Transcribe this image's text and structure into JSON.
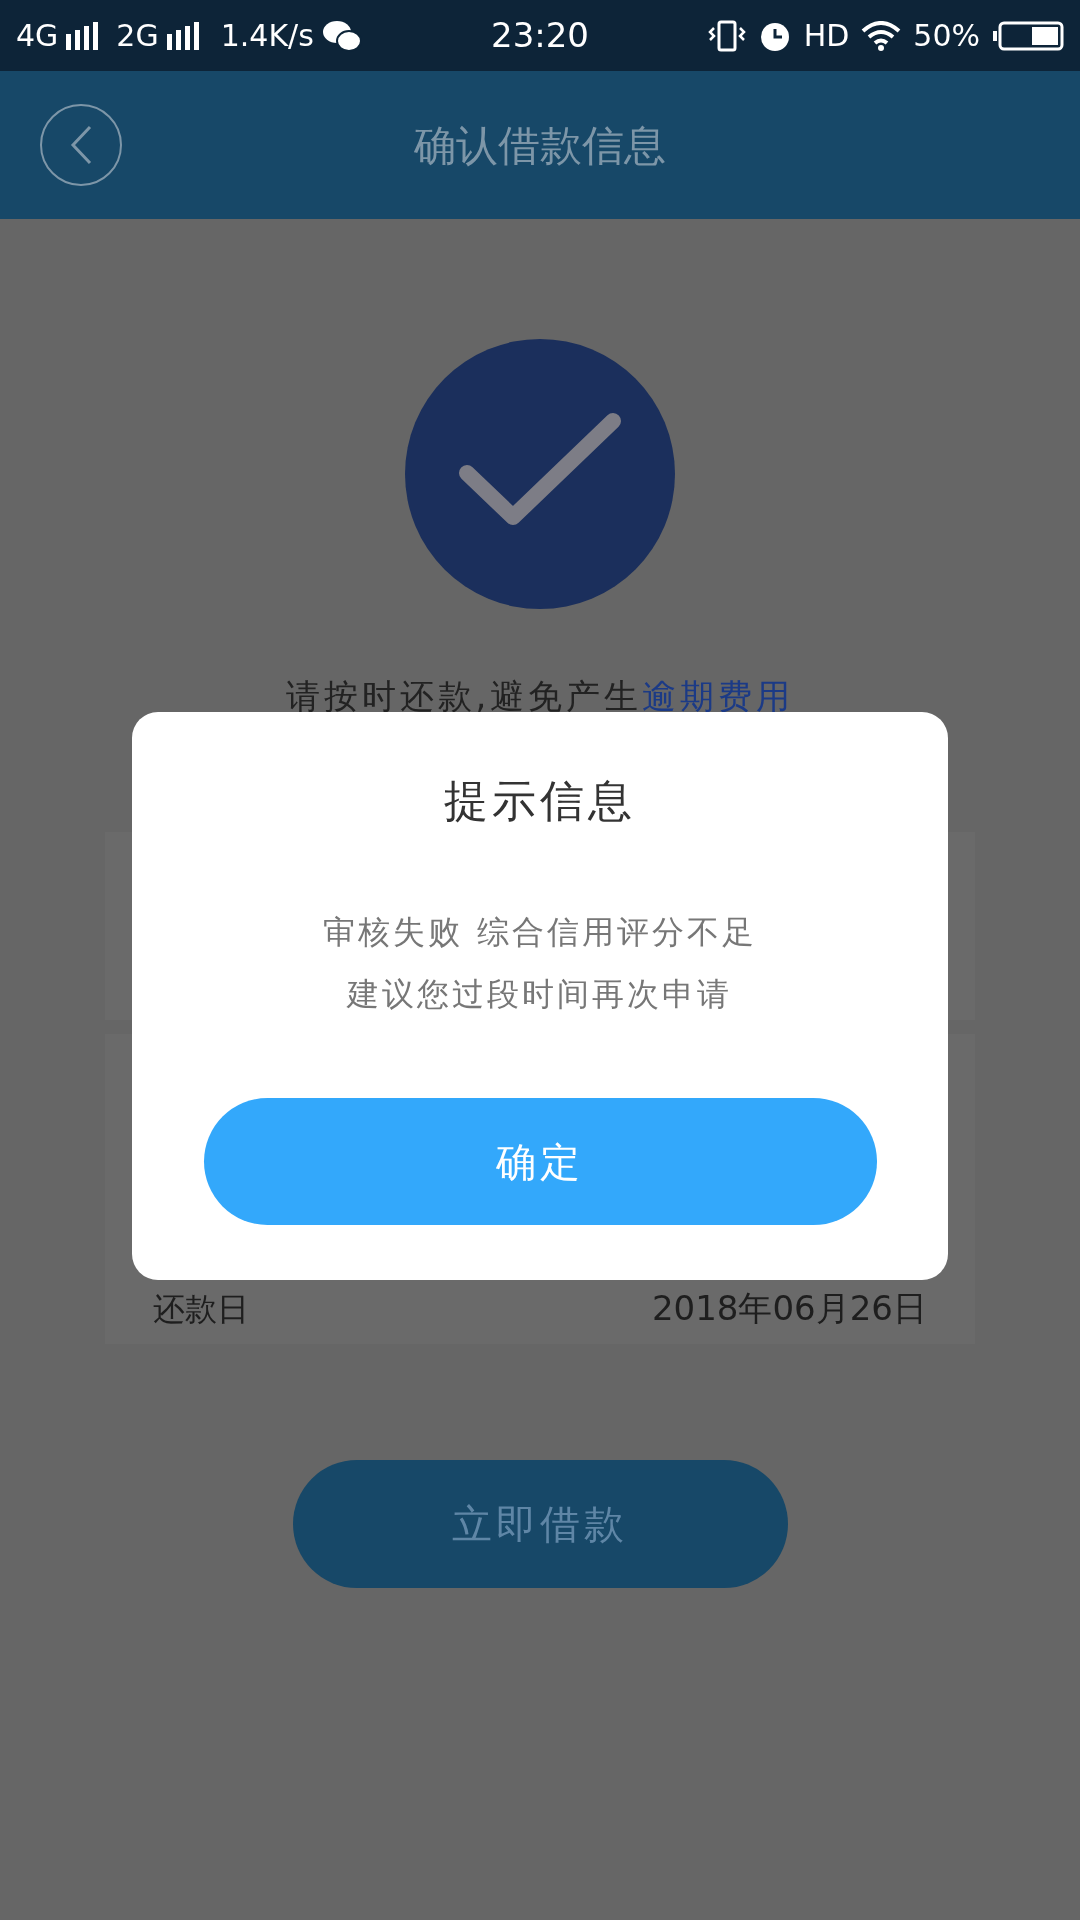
{
  "status_bar": {
    "network_1": "4G",
    "network_2": "2G",
    "speed": "1.4K/s",
    "time": "23:20",
    "hd": "HD",
    "battery": "50%"
  },
  "header": {
    "title": "确认借款信息"
  },
  "notice": {
    "text": "请按时还款,避免产生",
    "link": "逾期费用"
  },
  "details": [
    {
      "label": "还款日",
      "value": "2018年06月26日"
    }
  ],
  "primary_button": "立即借款",
  "dialog": {
    "title": "提示信息",
    "message_lines": [
      "审核失败 综合信用评分不足",
      "建议您过段时间再次申请"
    ],
    "button": "确定"
  }
}
